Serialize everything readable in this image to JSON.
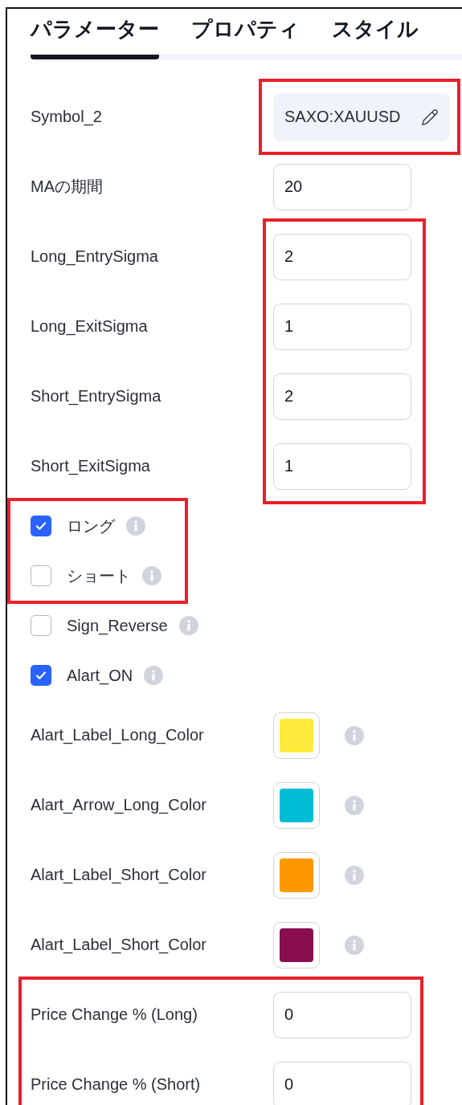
{
  "tabs": [
    {
      "label": "パラメーター",
      "selected": true
    },
    {
      "label": "プロパティ",
      "selected": false
    },
    {
      "label": "スタイル",
      "selected": false
    }
  ],
  "groups": [
    {
      "kind": "fields",
      "highlighted": true,
      "rows": [
        {
          "kind": "symbol",
          "label": "Symbol_2",
          "value": "SAXO:XAUUSD"
        }
      ]
    },
    {
      "kind": "fields",
      "highlighted": false,
      "rows": [
        {
          "kind": "number",
          "label": "MAの期間",
          "value": "20"
        }
      ]
    },
    {
      "kind": "fields",
      "highlighted": true,
      "rows": [
        {
          "kind": "number",
          "label": "Long_EntrySigma",
          "value": "2"
        },
        {
          "kind": "number",
          "label": "Long_ExitSigma",
          "value": "1"
        },
        {
          "kind": "number",
          "label": "Short_EntrySigma",
          "value": "2"
        },
        {
          "kind": "number",
          "label": "Short_ExitSigma",
          "value": "1"
        }
      ]
    },
    {
      "kind": "rows",
      "highlighted": true,
      "rows": [
        {
          "kind": "checkbox",
          "label": "ロング",
          "checked": true
        },
        {
          "kind": "checkbox",
          "label": "ショート",
          "checked": false
        }
      ]
    },
    {
      "kind": "rows",
      "highlighted": false,
      "rows": [
        {
          "kind": "checkbox",
          "label": "Sign_Reverse",
          "checked": false
        },
        {
          "kind": "checkbox",
          "label": "Alart_ON",
          "checked": true
        },
        {
          "kind": "color",
          "label": "Alart_Label_Long_Color",
          "color": "#ffeb3b"
        },
        {
          "kind": "color",
          "label": "Alart_Arrow_Long_Color",
          "color": "#00bcd4"
        },
        {
          "kind": "color",
          "label": "Alart_Label_Short_Color",
          "color": "#ff9800"
        },
        {
          "kind": "color",
          "label": "Alart_Label_Short_Color",
          "color": "#880e4f"
        }
      ]
    },
    {
      "kind": "rows",
      "highlighted": true,
      "rows": [
        {
          "kind": "number",
          "label": "Price Change % (Long)",
          "value": "0"
        },
        {
          "kind": "number",
          "label": "Price Change % (Short)",
          "value": "0"
        }
      ]
    }
  ]
}
